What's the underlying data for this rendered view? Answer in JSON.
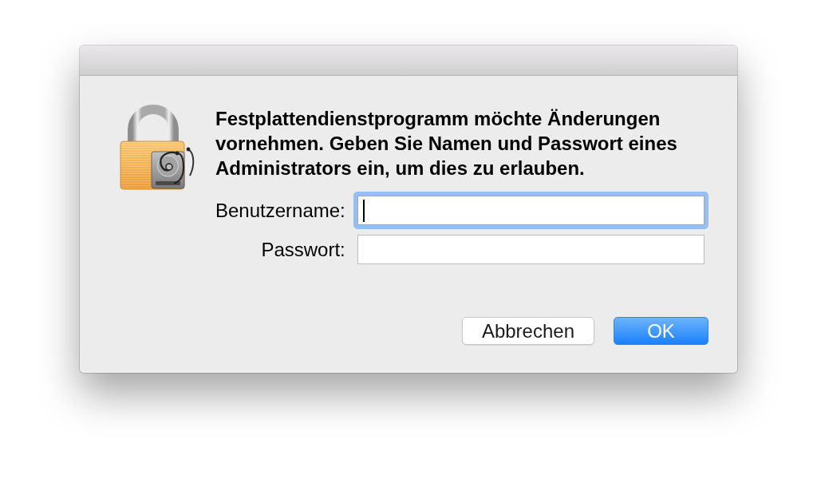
{
  "dialog": {
    "message": "Festplattendienstprogramm möchte Änderungen vornehmen. Geben Sie Namen und Passwort eines Administrators ein, um dies zu erlauben."
  },
  "fields": [
    {
      "label": "Benutzername:",
      "focused": true
    },
    {
      "label": "Passwort:",
      "focused": false
    }
  ],
  "buttons": [
    {
      "label": "Abbrechen",
      "default": false
    },
    {
      "label": "OK",
      "default": true
    }
  ]
}
